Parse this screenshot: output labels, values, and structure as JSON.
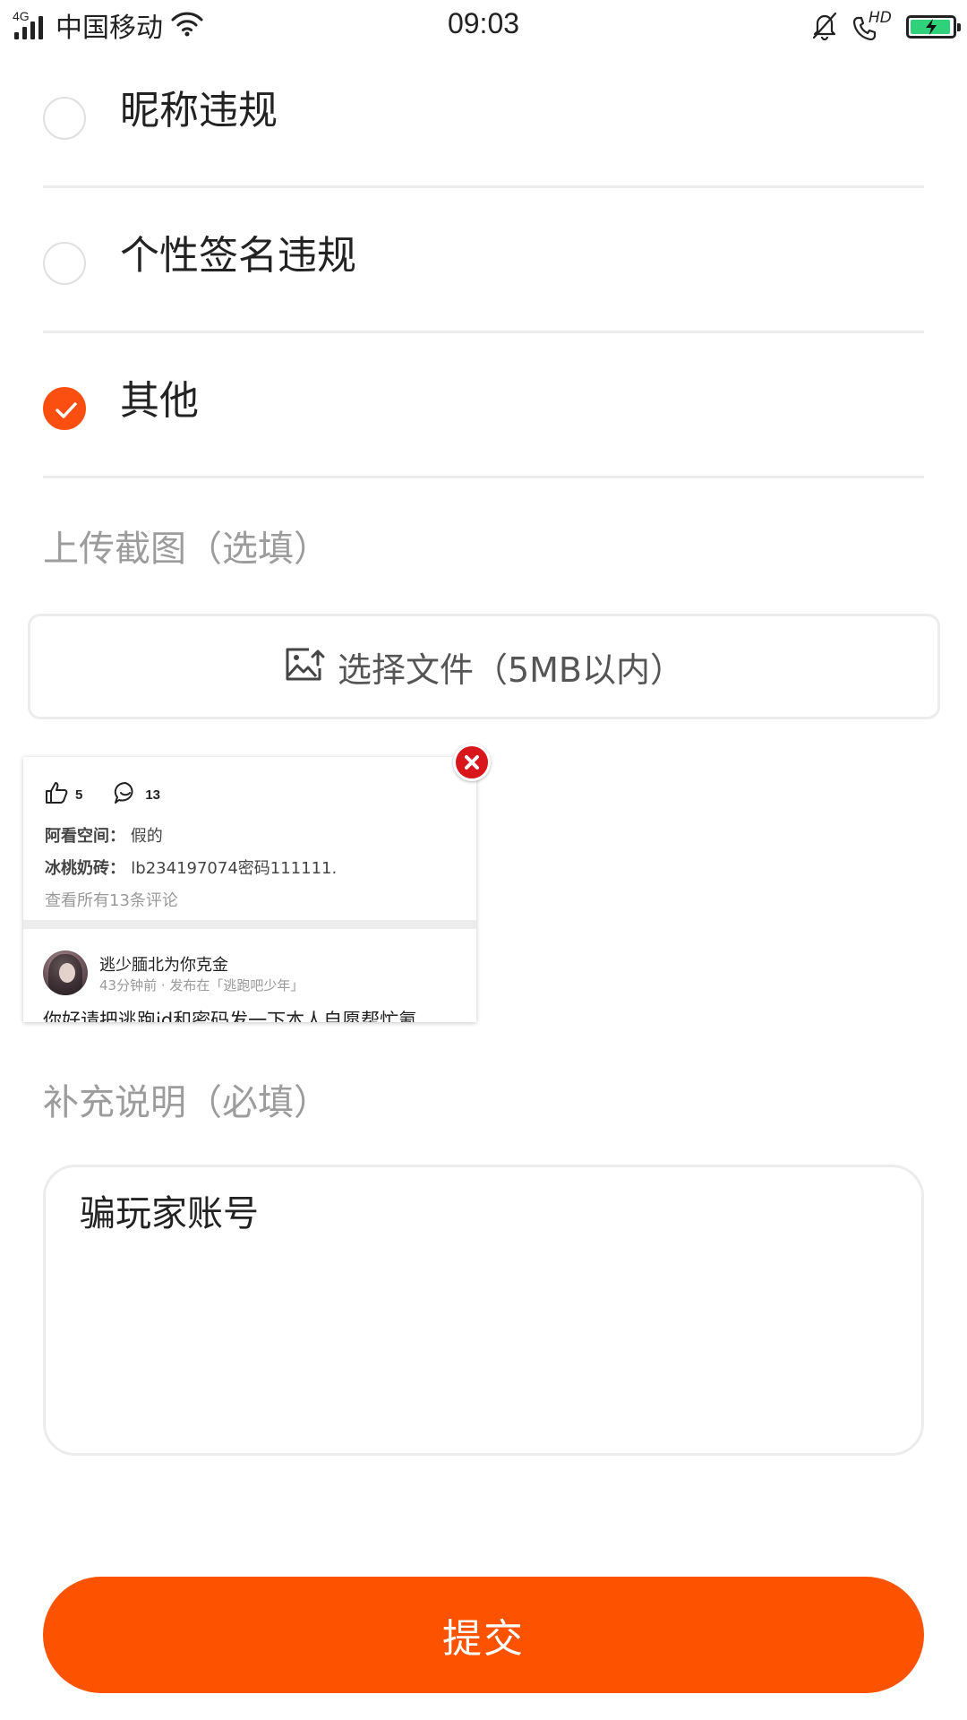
{
  "status_bar": {
    "network": "4G",
    "carrier": "中国移动",
    "time": "09:03",
    "hd_label": "HD",
    "battery_level": 0.95,
    "battery_color": "#2fd27a"
  },
  "options": [
    {
      "label": "昵称违规",
      "checked": false
    },
    {
      "label": "个性签名违规",
      "checked": false
    },
    {
      "label": "其他",
      "checked": true
    }
  ],
  "upload": {
    "title": "上传截图（选填）",
    "button_label": "选择文件（5MB以内）",
    "icon": "image-upload-icon"
  },
  "thumbnail": {
    "likes": "5",
    "comments": "13",
    "comment1_author": "阿看空间",
    "comment1_text": "假的",
    "comment2_author": "冰桃奶砖",
    "comment2_text": "lb234197074密码111111.",
    "view_all": "查看所有13条评论",
    "post_author": "逃少腼北为你克金",
    "post_meta": "43分钟前 · 发布在「逃跑吧少年」",
    "post_body": "你好请把逃跑id和密码发一下本人自愿帮忙氪"
  },
  "description": {
    "title": "补充说明（必填）",
    "value": "骗玩家账号"
  },
  "submit_label": "提交",
  "colors": {
    "accent": "#fb4f12",
    "submit": "#fd5300",
    "delete_badge": "#d8161b"
  }
}
